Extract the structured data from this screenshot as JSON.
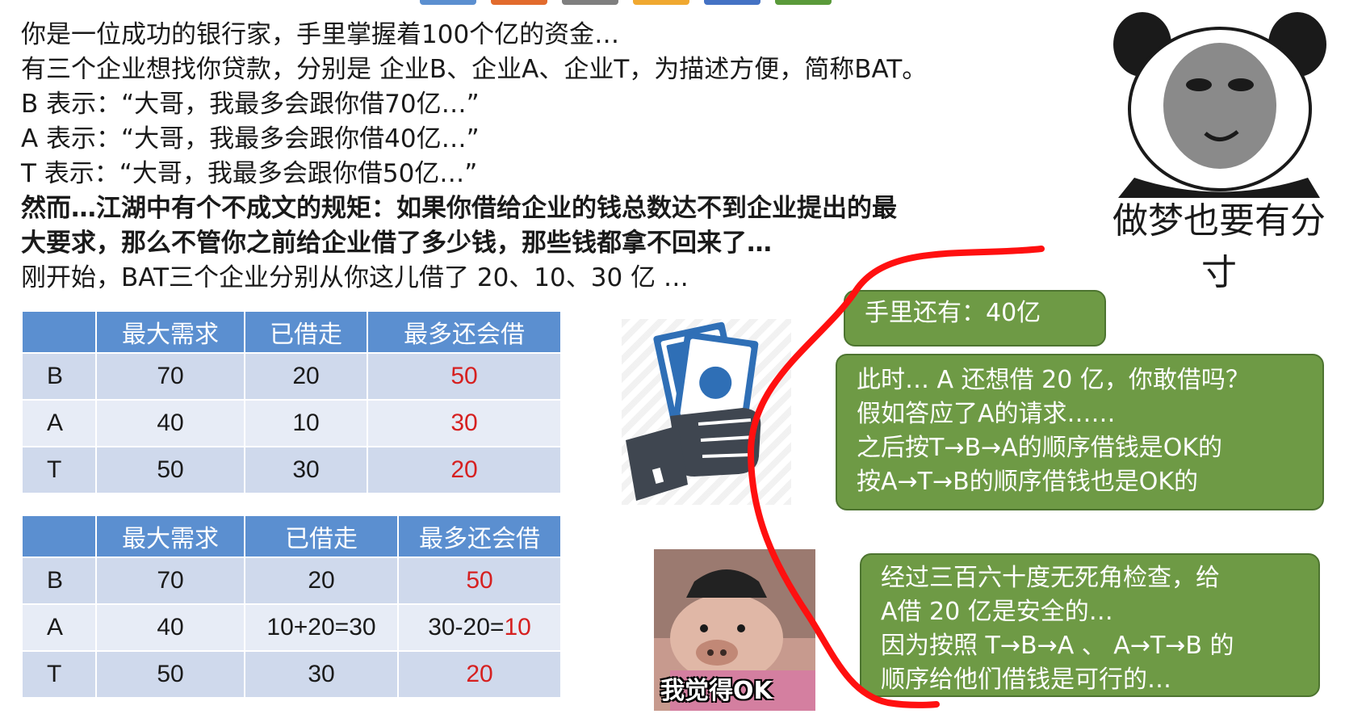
{
  "header": {
    "tab_colors": [
      "#5b8fd0",
      "#e26b2d",
      "#7f7f7f",
      "#f0a830",
      "#4472c4",
      "#5a9a3a"
    ]
  },
  "intro": {
    "lines": [
      "你是一位成功的银行家，手里掌握着100个亿的资金…",
      "有三个企业想找你贷款，分别是 企业B、企业A、企业T，为描述方便，简称BAT。",
      "B 表示：“大哥，我最多会跟你借70亿…”",
      "A 表示：“大哥，我最多会跟你借40亿…”",
      "T 表示：“大哥，我最多会跟你借50亿…”"
    ],
    "bold_lines": [
      "然而…江湖中有个不成文的规矩：如果你借给企业的钱总数达不到企业提出的最",
      "大要求，那么不管你之前给企业借了多少钱，那些钱都拿不回来了…"
    ],
    "last_line": "刚开始，BAT三个企业分别从你这儿借了 20、10、30 亿 …"
  },
  "table1": {
    "headers": [
      "",
      "最大需求",
      "已借走",
      "最多还会借"
    ],
    "rows": [
      {
        "name": "B",
        "max": "70",
        "borrowed": "20",
        "need_prefix": "",
        "need": "50"
      },
      {
        "name": "A",
        "max": "40",
        "borrowed": "10",
        "need_prefix": "",
        "need": "30"
      },
      {
        "name": "T",
        "max": "50",
        "borrowed": "30",
        "need_prefix": "",
        "need": "20"
      }
    ]
  },
  "table2": {
    "headers": [
      "",
      "最大需求",
      "已借走",
      "最多还会借"
    ],
    "rows": [
      {
        "name": "B",
        "max": "70",
        "borrowed": "20",
        "need_prefix": "",
        "need": "50"
      },
      {
        "name": "A",
        "max": "40",
        "borrowed": "10+20=30",
        "need_prefix": "30-20=",
        "need": "10"
      },
      {
        "name": "T",
        "max": "50",
        "borrowed": "30",
        "need_prefix": "",
        "need": "20"
      }
    ]
  },
  "callouts": {
    "remaining": "手里还有：40亿",
    "question_lines": [
      "此时… A 还想借 20 亿，你敢借吗？",
      "假如答应了A的请求……",
      "之后按T→B→A的顺序借钱是OK的",
      "按A→T→B的顺序借钱也是OK的"
    ],
    "answer_lines": [
      "经过三百六十度无死角检查，给",
      "A借 20 亿是安全的…",
      "因为按照 T→B→A 、 A→T→B 的",
      "顺序给他们借钱是可行的…"
    ]
  },
  "memes": {
    "panda_caption": "做梦也要有分寸",
    "pig_caption": "我觉得OK"
  },
  "colors": {
    "table_header": "#5b8fd0",
    "callout_green": "#6e9a45",
    "highlight_red": "#d62020",
    "annotation_red": "#ff1010"
  }
}
